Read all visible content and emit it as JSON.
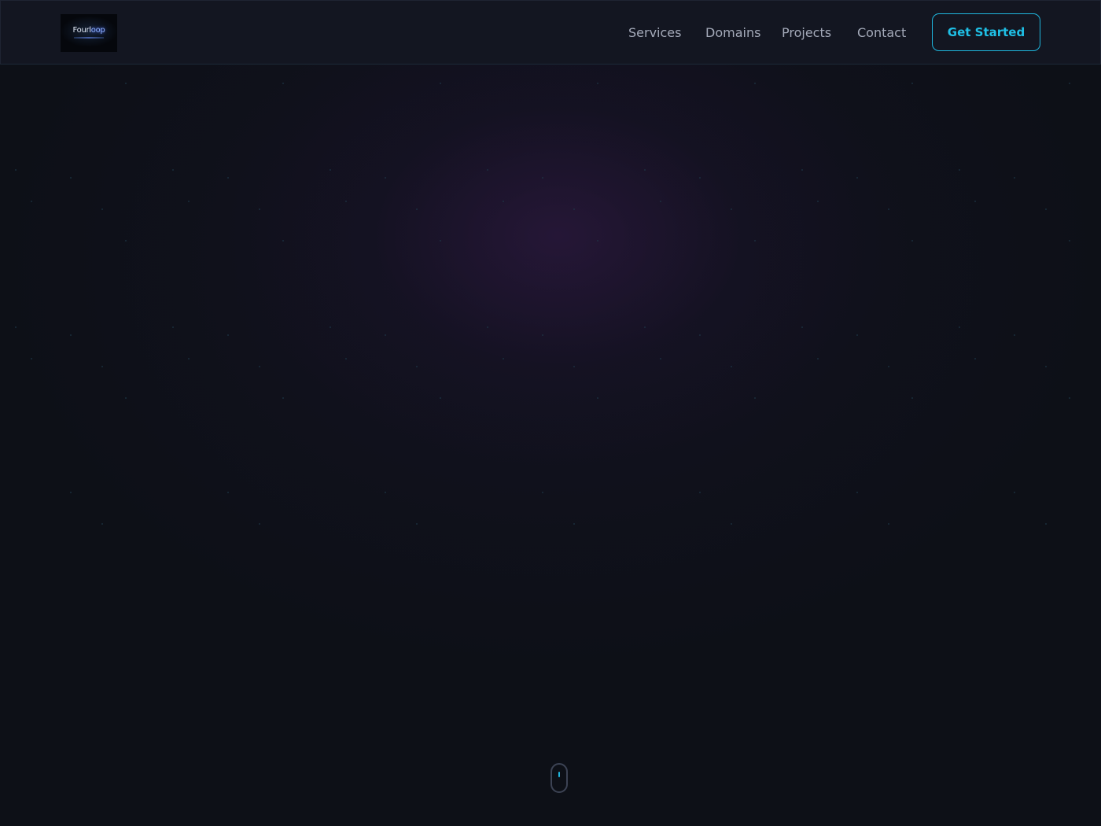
{
  "header": {
    "logo": {
      "text_main": "Fourl",
      "text_accent": "oop"
    },
    "nav": {
      "services": "Services",
      "domains": "Domains",
      "projects": "Projects",
      "contact": "Contact"
    },
    "cta_label": "Get Started"
  },
  "colors": {
    "background": "#0d1017",
    "navbar": "#131621",
    "accent": "#1fb7de",
    "nav_text": "#a4aab9",
    "hero_glow": "#341a48"
  },
  "icons": {
    "scroll_indicator": "mouse-scroll-icon"
  }
}
